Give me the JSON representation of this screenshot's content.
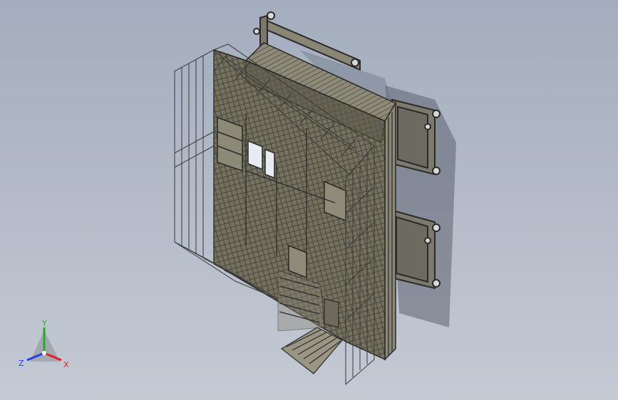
{
  "viewport": {
    "background_top": "#a3adbd",
    "background_bottom": "#c4cad4"
  },
  "model": {
    "edge_color": "#2a2a2a",
    "face_color": "#6f6b5c",
    "face_light": "#9a9684",
    "wire_color": "#3a3a3a"
  },
  "triad": {
    "x_label": "X",
    "y_label": "Y",
    "z_label": "Z",
    "x_color": "#e02020",
    "y_color": "#20b020",
    "z_color": "#2040e0"
  }
}
